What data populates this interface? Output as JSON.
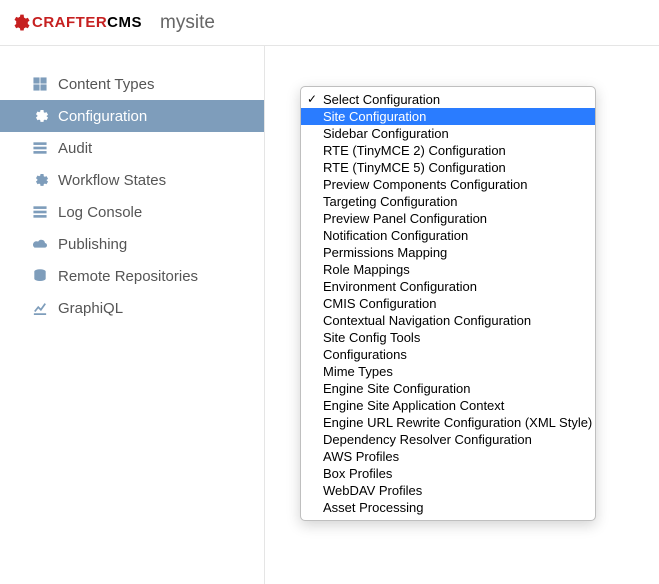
{
  "brand": {
    "name_prefix": "CRAFTER",
    "name_suffix": "CMS"
  },
  "site": {
    "name": "mysite"
  },
  "sidebar": {
    "items": [
      {
        "label": "Content Types",
        "icon": "grid-icon"
      },
      {
        "label": "Configuration",
        "icon": "gear-icon"
      },
      {
        "label": "Audit",
        "icon": "list-icon"
      },
      {
        "label": "Workflow States",
        "icon": "gear-icon"
      },
      {
        "label": "Log Console",
        "icon": "list-icon"
      },
      {
        "label": "Publishing",
        "icon": "cloud-icon"
      },
      {
        "label": "Remote Repositories",
        "icon": "database-icon"
      },
      {
        "label": "GraphiQL",
        "icon": "chart-icon"
      }
    ],
    "active_index": 1
  },
  "dropdown": {
    "checked_index": 0,
    "highlighted_index": 1,
    "options": [
      "Select Configuration",
      "Site Configuration",
      "Sidebar Configuration",
      "RTE (TinyMCE 2) Configuration",
      "RTE (TinyMCE 5) Configuration",
      "Preview Components Configuration",
      "Targeting Configuration",
      "Preview Panel Configuration",
      "Notification Configuration",
      "Permissions Mapping",
      "Role Mappings",
      "Environment Configuration",
      "CMIS Configuration",
      "Contextual Navigation Configuration",
      "Site Config Tools",
      "Configurations",
      "Mime Types",
      "Engine Site Configuration",
      "Engine Site Application Context",
      "Engine URL Rewrite Configuration (XML Style)",
      "Dependency Resolver Configuration",
      "AWS Profiles",
      "Box Profiles",
      "WebDAV Profiles",
      "Asset Processing"
    ]
  }
}
